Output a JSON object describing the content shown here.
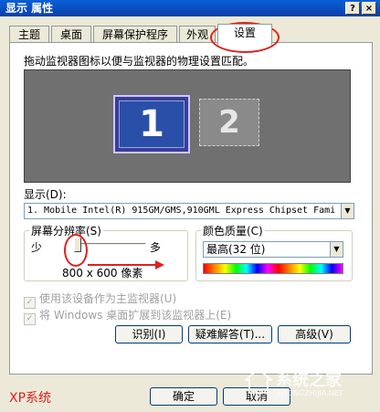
{
  "window": {
    "title": "显示 属性",
    "help_btn": "?",
    "close_btn": "×"
  },
  "tabs": [
    "主题",
    "桌面",
    "屏幕保护程序",
    "外观",
    "设置"
  ],
  "description": "拖动监视器图标以便与监视器的物理设置匹配。",
  "monitors": [
    "1",
    "2"
  ],
  "display": {
    "label": "显示(D):",
    "value": "1. Mobile Intel(R) 915GM/GMS,910GML Express Chipset Fami"
  },
  "resolution": {
    "group_title": "屏幕分辨率(S)",
    "less": "少",
    "more": "多",
    "value": "800 x 600 像素",
    "level": 0
  },
  "color_quality": {
    "group_title": "颜色质量(C)",
    "value": "最高(32 位)"
  },
  "checkboxes": [
    "使用该设备作为主监视器(U)",
    "将 Windows 桌面扩展到该监视器上(E)"
  ],
  "buttons": {
    "identify": "识别(I)",
    "troubleshoot": "疑难解答(T)...",
    "advanced": "高级(V)",
    "ok": "确定",
    "cancel": "取消"
  },
  "caption": "XP系统",
  "watermark": {
    "brand": "系统之家",
    "url": "XITONGZHIJIA.NET"
  },
  "colors": {
    "annotation": "#e02020",
    "titlebar": "#0a5fd8"
  }
}
